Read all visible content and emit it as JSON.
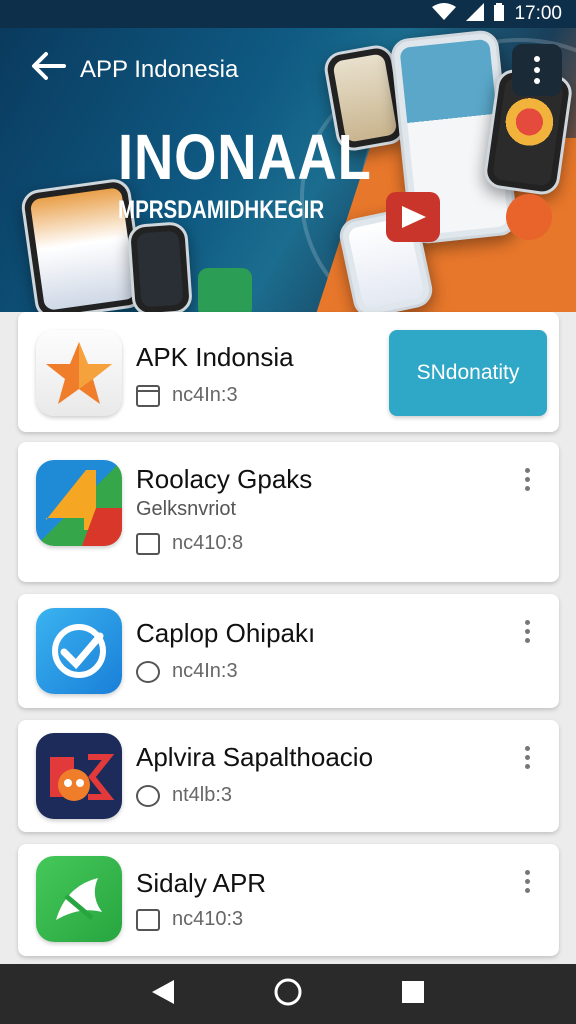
{
  "status_bar": {
    "time": "17:00",
    "icons": [
      "wifi-icon",
      "signal-icon",
      "battery-icon"
    ]
  },
  "header": {
    "title": "APP Indonesia",
    "headline": "INONAAL",
    "subheadline": "MPRSDAMIDHKEGIR",
    "back_icon": "arrow-left-icon",
    "menu_icon": "more-vert-icon"
  },
  "apps": [
    {
      "name": "APK Indonsia",
      "developer": "",
      "meta": "nc4In:3",
      "icon": "star-icon",
      "icon_color": "#f07d2a",
      "action_label": "SNdonatity",
      "action_color": "#2fa7c6"
    },
    {
      "name": "Roolacy Gpaks",
      "developer": "Gelksnvriot",
      "meta": "nc410:8",
      "icon": "play-4-icon",
      "icon_color": "#1f8ad6"
    },
    {
      "name": "Caplop Ohipakı",
      "developer": "",
      "meta": "nc4In:3",
      "icon": "check-badge-icon",
      "icon_color": "#1b8ee8"
    },
    {
      "name": "Aplvira Sapalthoacio",
      "developer": "",
      "meta": "nt4lb:3",
      "icon": "owl-logo-icon",
      "icon_color": "#1c2b5a"
    },
    {
      "name": "Sidaly APR",
      "developer": "",
      "meta": "nc410:3",
      "icon": "whatsapp-like-icon",
      "icon_color": "#34b648"
    }
  ],
  "nav_bar": {
    "back": "nav-back-icon",
    "home": "nav-home-icon",
    "recents": "nav-recents-icon"
  }
}
